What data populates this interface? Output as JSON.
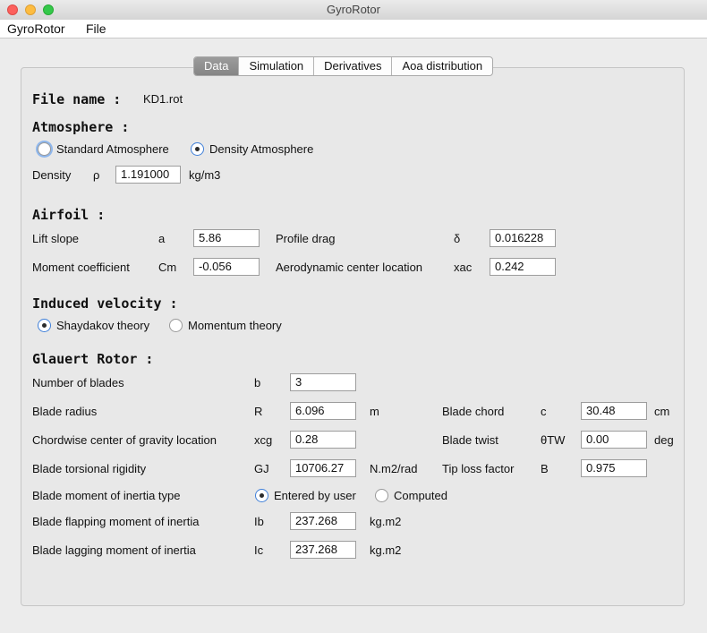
{
  "window": {
    "title": "GyroRotor"
  },
  "menu": [
    "GyroRotor",
    "File"
  ],
  "tabs": [
    "Data",
    "Simulation",
    "Derivatives",
    "Aoa distribution"
  ],
  "file": {
    "label": "File name :",
    "value": "KD1.rot"
  },
  "atmosphere": {
    "heading": "Atmosphere :",
    "options": [
      "Standard Atmosphere",
      "Density Atmosphere"
    ],
    "selected": "Density Atmosphere",
    "density": {
      "label": "Density",
      "symbol": "ρ",
      "value": "1.191000",
      "unit": "kg/m3"
    }
  },
  "airfoil": {
    "heading": "Airfoil :",
    "lift_slope": {
      "label": "Lift slope",
      "symbol": "a",
      "value": "5.86"
    },
    "profile_drag": {
      "label": "Profile drag",
      "symbol": "δ",
      "value": "0.016228"
    },
    "moment_coef": {
      "label": "Moment coefficient",
      "symbol": "Cm",
      "value": "-0.056"
    },
    "aero_center": {
      "label": "Aerodynamic center location",
      "symbol": "xac",
      "value": "0.242"
    }
  },
  "induced": {
    "heading": "Induced velocity :",
    "options": [
      "Shaydakov theory",
      "Momentum theory"
    ],
    "selected": "Shaydakov theory"
  },
  "rotor": {
    "heading": "Glauert Rotor :",
    "num_blades": {
      "label": "Number of blades",
      "symbol": "b",
      "value": "3"
    },
    "radius": {
      "label": "Blade radius",
      "symbol": "R",
      "value": "6.096",
      "unit": "m"
    },
    "chord": {
      "label": "Blade chord",
      "symbol": "c",
      "value": "30.48",
      "unit": "cm"
    },
    "cg": {
      "label": "Chordwise center of gravity location",
      "symbol": "xcg",
      "value": "0.28"
    },
    "twist": {
      "label": "Blade twist",
      "symbol": "θTW",
      "value": "0.00",
      "unit": "deg"
    },
    "torsion": {
      "label": "Blade torsional rigidity",
      "symbol": "GJ",
      "value": "10706.27",
      "unit": "N.m2/rad"
    },
    "tip_loss": {
      "label": "Tip loss factor",
      "symbol": "B",
      "value": "0.975"
    },
    "inertia_type": {
      "label": "Blade moment of inertia type",
      "options": [
        "Entered by user",
        "Computed"
      ],
      "selected": "Entered by user"
    },
    "flap_inertia": {
      "label": "Blade flapping moment of inertia",
      "symbol": "Ib",
      "value": "237.268",
      "unit": "kg.m2"
    },
    "lag_inertia": {
      "label": "Blade lagging moment of inertia",
      "symbol": "Ic",
      "value": "237.268",
      "unit": "kg.m2"
    }
  }
}
